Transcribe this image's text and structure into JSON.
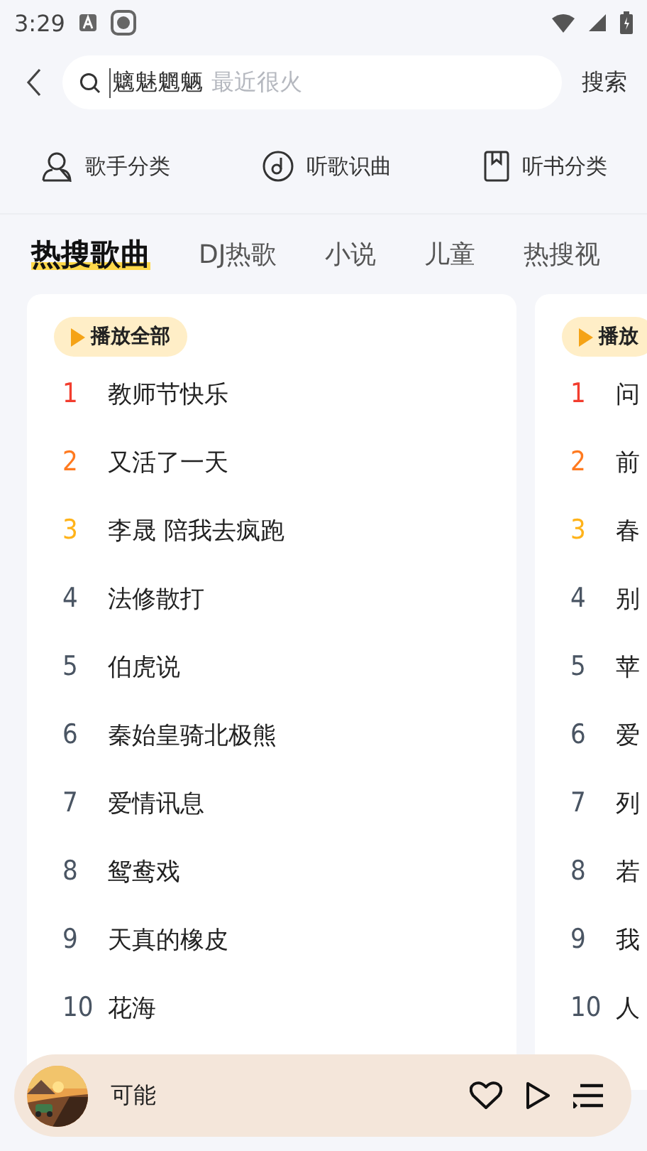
{
  "status_bar": {
    "time": "3:29"
  },
  "search": {
    "value": "魑魅魍魉",
    "placeholder": "最近很火",
    "button": "搜索"
  },
  "categories": [
    {
      "kind": "singer",
      "label": "歌手分类"
    },
    {
      "kind": "recognize",
      "label": "听歌识曲"
    },
    {
      "kind": "book",
      "label": "听书分类"
    }
  ],
  "tabs": [
    {
      "label": "热搜歌曲",
      "selected": true
    },
    {
      "label": "DJ热歌",
      "selected": false
    },
    {
      "label": "小说",
      "selected": false
    },
    {
      "label": "儿童",
      "selected": false
    },
    {
      "label": "热搜视",
      "selected": false
    }
  ],
  "cards": [
    {
      "play_all": "播放全部",
      "songs": [
        {
          "rank": "1",
          "title": "教师节快乐",
          "color": "#f23d2e"
        },
        {
          "rank": "2",
          "title": "又活了一天",
          "color": "#ff7a1f"
        },
        {
          "rank": "3",
          "title": "李晟 陪我去疯跑",
          "color": "#ffb31a"
        },
        {
          "rank": "4",
          "title": "法修散打",
          "color": "#4a5563"
        },
        {
          "rank": "5",
          "title": "伯虎说",
          "color": "#4a5563"
        },
        {
          "rank": "6",
          "title": "秦始皇骑北极熊",
          "color": "#4a5563"
        },
        {
          "rank": "7",
          "title": "爱情讯息",
          "color": "#4a5563"
        },
        {
          "rank": "8",
          "title": "鸳鸯戏",
          "color": "#4a5563"
        },
        {
          "rank": "9",
          "title": "天真的橡皮",
          "color": "#4a5563"
        },
        {
          "rank": "10",
          "title": "花海",
          "color": "#4a5563"
        }
      ]
    },
    {
      "play_all": "播放",
      "songs": [
        {
          "rank": "1",
          "title": "问",
          "color": "#f23d2e"
        },
        {
          "rank": "2",
          "title": "前",
          "color": "#ff7a1f"
        },
        {
          "rank": "3",
          "title": "春",
          "color": "#ffb31a"
        },
        {
          "rank": "4",
          "title": "别",
          "color": "#4a5563"
        },
        {
          "rank": "5",
          "title": "苹",
          "color": "#4a5563"
        },
        {
          "rank": "6",
          "title": "爱",
          "color": "#4a5563"
        },
        {
          "rank": "7",
          "title": "列",
          "color": "#4a5563"
        },
        {
          "rank": "8",
          "title": "若",
          "color": "#4a5563"
        },
        {
          "rank": "9",
          "title": "我",
          "color": "#4a5563"
        },
        {
          "rank": "10",
          "title": "人",
          "color": "#4a5563"
        }
      ]
    }
  ],
  "player": {
    "title": "可能"
  }
}
